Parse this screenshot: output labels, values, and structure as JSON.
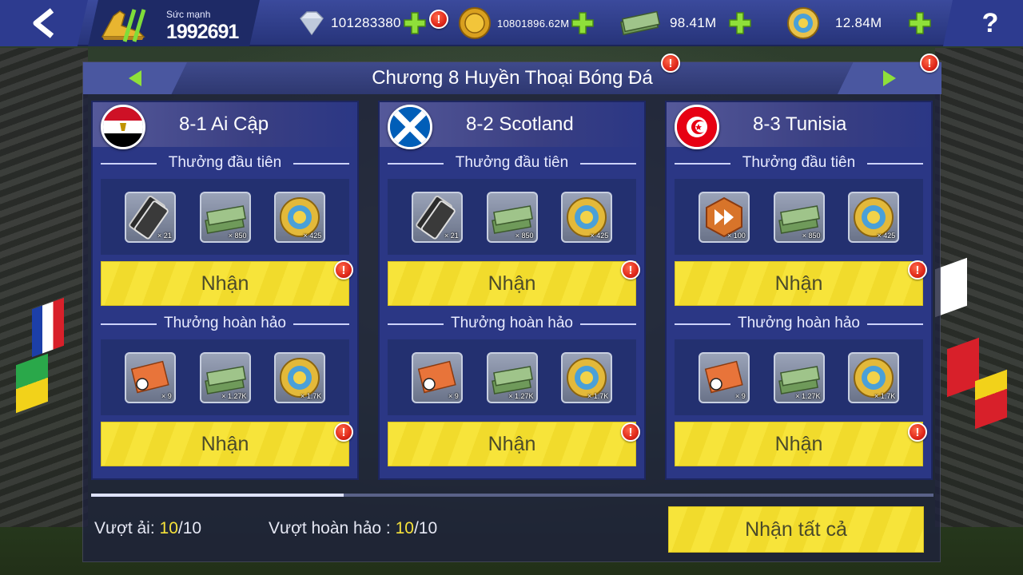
{
  "topbar": {
    "power_label": "Sức mạnh",
    "power_value": "1992691",
    "resources": [
      {
        "icon": "diamond-icon",
        "value": "101283380"
      },
      {
        "icon": "gold-coin-icon",
        "value": "10801896.62M"
      },
      {
        "icon": "cash-icon",
        "value": "98.41M"
      },
      {
        "icon": "medal-coin-icon",
        "value": "12.84M"
      }
    ],
    "help_label": "?"
  },
  "chapter": {
    "title": "Chương 8 Huyền Thoại Bóng Đá"
  },
  "alert_symbol": "!",
  "stages": [
    {
      "title": "8-1 Ai Cập",
      "flag": "egypt-flag-icon",
      "first_label": "Thưởng đầu tiên",
      "first_rewards": [
        {
          "icon": "skill-ticket-icon",
          "qty": "× 21"
        },
        {
          "icon": "cash-stack-icon",
          "qty": "× 850"
        },
        {
          "icon": "laurel-coin-icon",
          "qty": "× 425"
        }
      ],
      "claim_label": "Nhận",
      "perfect_label": "Thưởng hoàn hảo",
      "perfect_rewards": [
        {
          "icon": "card-pack-icon",
          "qty": "× 9"
        },
        {
          "icon": "cash-stack-icon",
          "qty": "× 1.27K"
        },
        {
          "icon": "laurel-coin-icon",
          "qty": "× 1.7K"
        }
      ]
    },
    {
      "title": "8-2 Scotland",
      "flag": "scotland-flag-icon",
      "first_label": "Thưởng đầu tiên",
      "first_rewards": [
        {
          "icon": "skill-ticket-icon",
          "qty": "× 21"
        },
        {
          "icon": "cash-stack-icon",
          "qty": "× 850"
        },
        {
          "icon": "laurel-coin-icon",
          "qty": "× 425"
        }
      ],
      "claim_label": "Nhận",
      "perfect_label": "Thưởng hoàn hảo",
      "perfect_rewards": [
        {
          "icon": "card-pack-icon",
          "qty": "× 9"
        },
        {
          "icon": "cash-stack-icon",
          "qty": "× 1.27K"
        },
        {
          "icon": "laurel-coin-icon",
          "qty": "× 1.7K"
        }
      ]
    },
    {
      "title": "8-3 Tunisia",
      "flag": "tunisia-flag-icon",
      "first_label": "Thưởng đầu tiên",
      "first_rewards": [
        {
          "icon": "fast-forward-icon",
          "qty": "× 100"
        },
        {
          "icon": "cash-stack-icon",
          "qty": "× 850"
        },
        {
          "icon": "laurel-coin-icon",
          "qty": "× 425"
        }
      ],
      "claim_label": "Nhận",
      "perfect_label": "Thưởng hoàn hảo",
      "perfect_rewards": [
        {
          "icon": "card-pack-icon",
          "qty": "× 9"
        },
        {
          "icon": "cash-stack-icon",
          "qty": "× 1.27K"
        },
        {
          "icon": "laurel-coin-icon",
          "qty": "× 1.7K"
        }
      ]
    }
  ],
  "footer": {
    "scroll_progress": 0.3,
    "cleared_label": "Vượt ải:",
    "cleared_current": "10",
    "cleared_total": "/10",
    "perfect_label": "Vượt hoàn hảo :",
    "perfect_current": "10",
    "perfect_total": "/10",
    "claim_all_label": "Nhận tất cả"
  },
  "colors": {
    "accent_yellow": "#f7e43a",
    "panel_blue": "#2b3785",
    "alert_red": "#e0281a",
    "plus_green": "#8fe03a"
  }
}
